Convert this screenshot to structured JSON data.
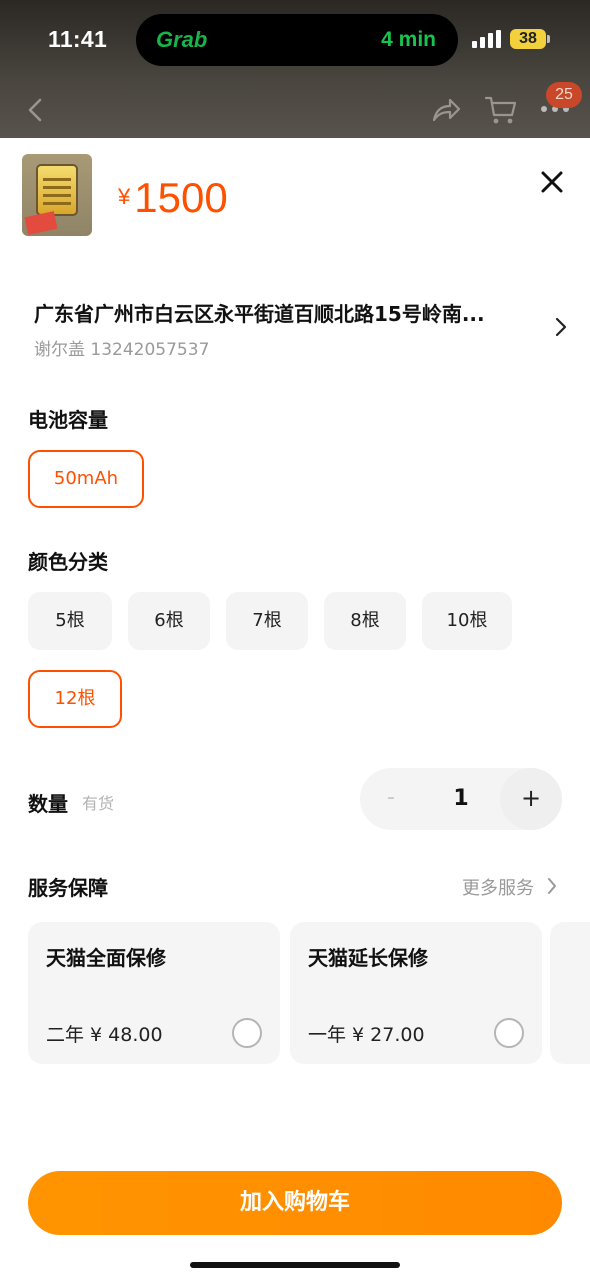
{
  "status_bar": {
    "time": "11:41",
    "island_app": "Grab",
    "island_eta": "4 min",
    "battery": "38"
  },
  "nav": {
    "more_badge": "25",
    "icons": [
      "back-chevron-icon",
      "share-icon",
      "cart-icon",
      "more-icon"
    ]
  },
  "product": {
    "currency": "¥",
    "price": "1500"
  },
  "address": {
    "line": "广东省广州市白云区永平街道百顺北路15号岭南...",
    "contact": "谢尔盖 13242057537"
  },
  "battery_capacity": {
    "title": "电池容量",
    "options": [
      {
        "label": "50mAh",
        "selected": true
      }
    ]
  },
  "color_category": {
    "title": "颜色分类",
    "options": [
      {
        "label": "5根",
        "selected": false
      },
      {
        "label": "6根",
        "selected": false
      },
      {
        "label": "7根",
        "selected": false
      },
      {
        "label": "8根",
        "selected": false
      },
      {
        "label": "10根",
        "selected": false
      },
      {
        "label": "12根",
        "selected": true
      }
    ]
  },
  "quantity": {
    "title": "数量",
    "stock": "有货",
    "minus": "-",
    "value": "1",
    "plus": "+"
  },
  "services": {
    "title": "服务保障",
    "more": "更多服务",
    "cards": [
      {
        "title": "天猫全面保修",
        "price": "二年 ¥ 48.00"
      },
      {
        "title": "天猫延长保修",
        "price": "一年 ¥ 27.00"
      }
    ]
  },
  "actions": {
    "add_to_cart": "加入购物车"
  },
  "colors": {
    "accent": "#ff5000",
    "cta": "#ff8a00"
  }
}
